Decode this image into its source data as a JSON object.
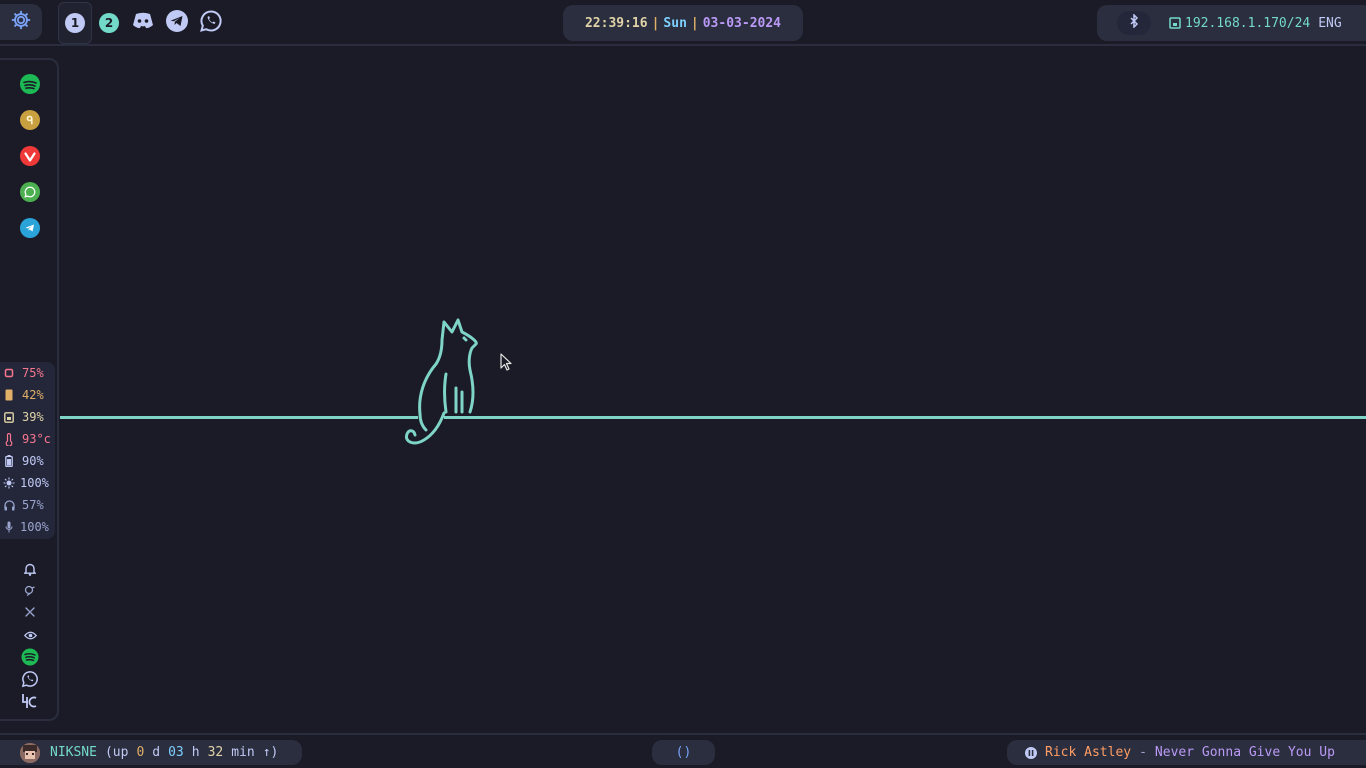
{
  "topbar": {
    "launcher_icon": "gear-icon",
    "workspaces": [
      {
        "label": "1",
        "color": "#c0caf5",
        "active": true
      },
      {
        "label": "2",
        "color": "#73daca",
        "active": false
      }
    ],
    "pinned_apps": [
      "discord-icon",
      "telegram-icon",
      "whatsapp-icon"
    ],
    "clock": {
      "time": "22:39:16",
      "sep1": "|",
      "day": "Sun",
      "sep2": "|",
      "date": "03-03-2024"
    },
    "bluetooth_icon": "bluetooth-icon",
    "network": {
      "icon": "ethernet-icon",
      "ip": "192.168.1.170/24",
      "layout": "ENG"
    }
  },
  "sidebar": {
    "apps": [
      {
        "name": "spotify",
        "color": "#1db954"
      },
      {
        "name": "app-c",
        "color": "#c9a040"
      },
      {
        "name": "vivaldi",
        "color": "#ef3939"
      },
      {
        "name": "whatsapp",
        "color": "#4caf50"
      },
      {
        "name": "telegram",
        "color": "#2aa3d9"
      }
    ],
    "stats": [
      {
        "name": "cpu",
        "value": "75%",
        "color": "#f7768e"
      },
      {
        "name": "ram",
        "value": "42%",
        "color": "#e0af68"
      },
      {
        "name": "disk",
        "value": "39%",
        "color": "#e0d3a8"
      },
      {
        "name": "temp",
        "value": "93°c",
        "color": "#f7768e"
      },
      {
        "name": "battery",
        "value": "90%",
        "color": "#c0caf5"
      },
      {
        "name": "brightness",
        "value": "100%",
        "color": "#c0caf5"
      },
      {
        "name": "volume",
        "value": "57%",
        "color": "#9aa5ce"
      },
      {
        "name": "mic",
        "value": "100%",
        "color": "#9aa5ce"
      }
    ],
    "tray": [
      "bell-icon",
      "idle-icon",
      "no-tools-icon",
      "eye-icon",
      "spotify-tray-icon",
      "whatsapp-tray-icon",
      "app-c-tray-icon"
    ]
  },
  "bottombar": {
    "user": {
      "name": "NIKSNE",
      "open": "(up",
      "days": "0",
      "d": "d",
      "hours": "03",
      "h": "h",
      "mins": "32",
      "m": "min",
      "arrow": "↑)"
    },
    "center": "()",
    "music": {
      "artist": "Rick Astley",
      "sep": "-",
      "title": "Never Gonna Give You Up",
      "state_icon": "pause-icon"
    }
  },
  "colors": {
    "accent": "#73daca",
    "bg": "#1a1b26",
    "pill": "#2b2e3e"
  }
}
